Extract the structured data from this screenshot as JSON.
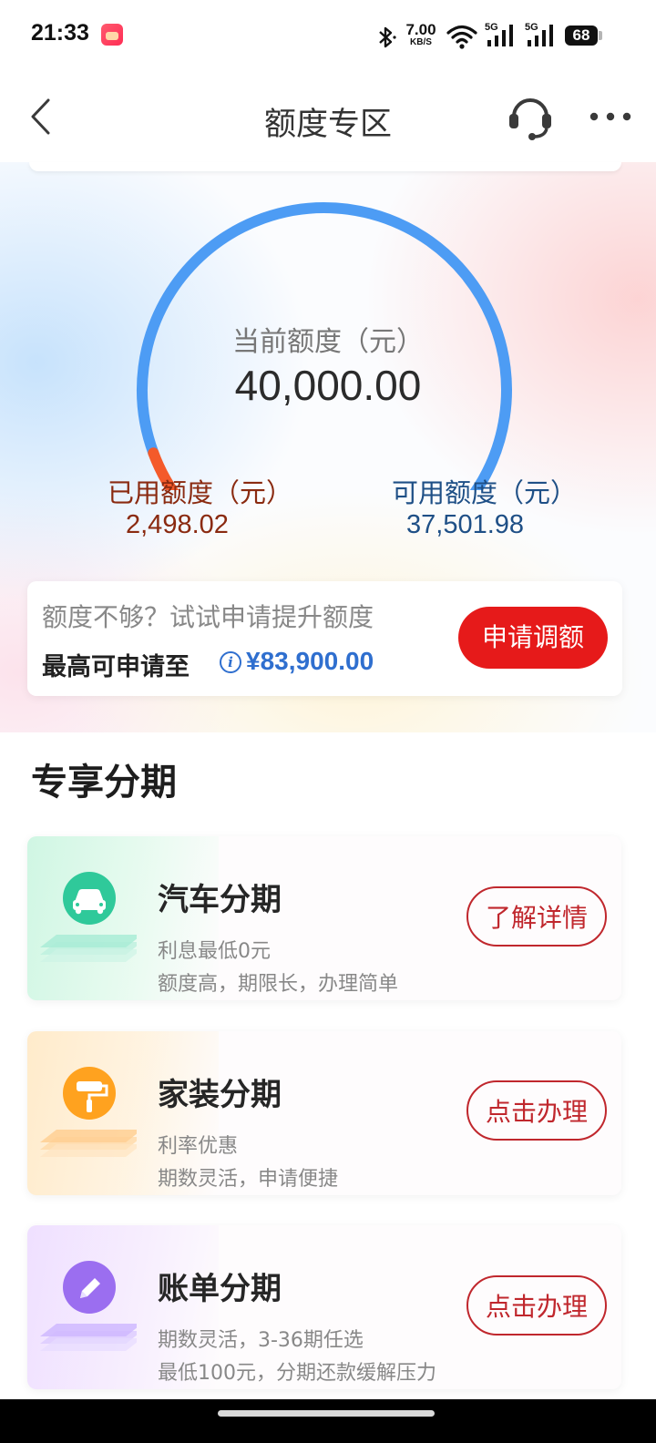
{
  "status_bar": {
    "time": "21:33",
    "network_speed_value": "7.00",
    "network_speed_unit": "KB/S",
    "signal_1": "5G",
    "signal_2": "5G",
    "battery": "68"
  },
  "nav": {
    "title": "额度专区",
    "back_icon": "chevron-left-icon",
    "service_icon": "headset-icon",
    "more_icon": "more-dots-icon"
  },
  "quota": {
    "current_label": "当前额度（元）",
    "current_value": "40,000.00",
    "used_label": "已用额度（元）",
    "used_value": "2,498.02",
    "available_label": "可用额度（元）",
    "available_value": "37,501.98",
    "used_fraction": 0.0625,
    "colors": {
      "available_arc": "#4d9cf4",
      "used_arc": "#f45a2a"
    }
  },
  "upgrade": {
    "prompt": "额度不够？试试申请提升额度",
    "max_label": "最高可申请至",
    "max_value": "¥83,900.00",
    "button_label": "申请调额"
  },
  "installments": {
    "section_title": "专享分期",
    "items": [
      {
        "title": "汽车分期",
        "line1": "利息最低0元",
        "line2": "额度高，期限长，办理简单",
        "action": "了解详情",
        "icon": "car-icon",
        "color": "#2fc99a"
      },
      {
        "title": "家装分期",
        "line1": "利率优惠",
        "line2": "期数灵活，申请便捷",
        "action": "点击办理",
        "icon": "paint-roller-icon",
        "color": "#ffa21f"
      },
      {
        "title": "账单分期",
        "line1": "期数灵活，3-36期任选",
        "line2": "最低100元，分期还款缓解压力",
        "action": "点击办理",
        "icon": "pencil-icon",
        "color": "#9b6ef0"
      }
    ]
  }
}
